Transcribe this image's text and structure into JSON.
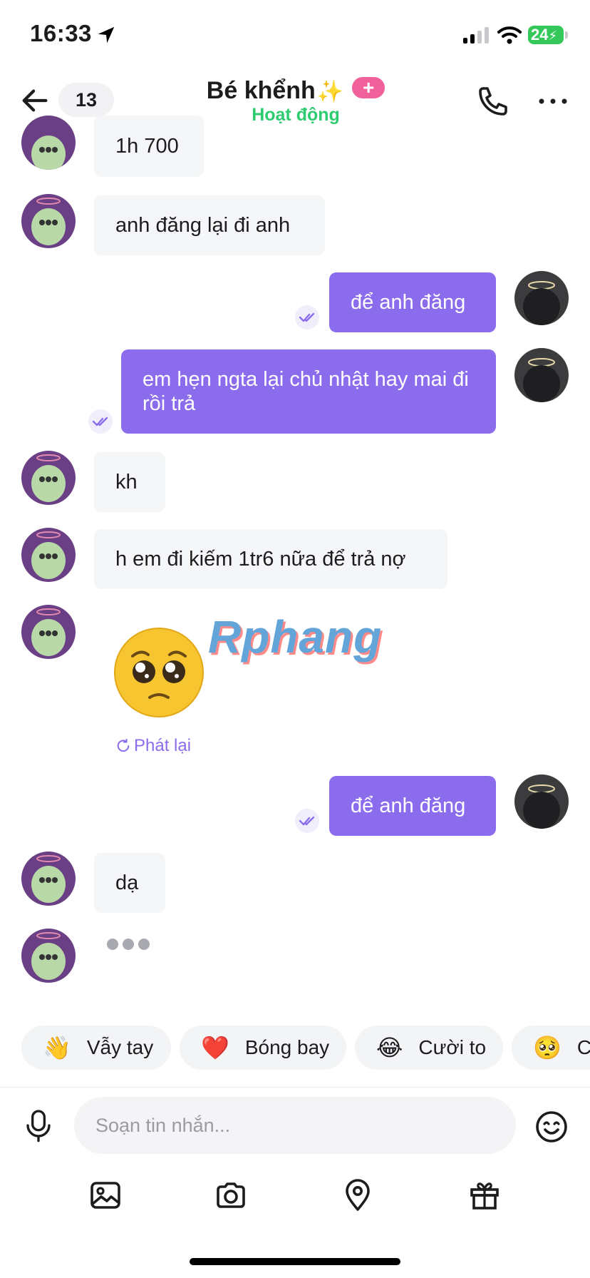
{
  "status_bar": {
    "time": "16:33",
    "battery": "24"
  },
  "header": {
    "unread_count": "13",
    "contact_name": "Bé khểnh",
    "name_emoji": "✨",
    "plus_label": "+",
    "status": "Hoạt động"
  },
  "messages": [
    {
      "from": "them",
      "text": "1h 700"
    },
    {
      "from": "them",
      "text": "anh đăng lại đi anh"
    },
    {
      "from": "me",
      "text": "để anh đăng"
    },
    {
      "from": "me",
      "text": "em hẹn ngta lại chủ nhật hay mai đi rồi trả"
    },
    {
      "from": "them",
      "text": "kh"
    },
    {
      "from": "them",
      "text": "h em đi kiếm 1tr6 nữa để trả nợ"
    },
    {
      "from": "them",
      "sticker": "pleading-face",
      "replay_label": "Phát lại"
    },
    {
      "from": "me",
      "text": "để anh đăng"
    },
    {
      "from": "them",
      "text": "dạ"
    },
    {
      "from": "them",
      "typing": true
    }
  ],
  "watermark": "Rphang",
  "quick_reactions": [
    {
      "emoji": "👋",
      "label": "Vẫy tay"
    },
    {
      "emoji": "❤️",
      "label": "Bóng bay"
    },
    {
      "emoji": "😂",
      "label": "Cười to"
    },
    {
      "emoji": "🥺",
      "label": "C"
    }
  ],
  "composer": {
    "placeholder": "Soạn tin nhắn..."
  },
  "toolbar": [
    "image-icon",
    "camera-icon",
    "location-icon",
    "gift-icon"
  ],
  "colors": {
    "accent": "#8b6cec",
    "online": "#2ecc71",
    "incoming_bubble": "#f5f6f8"
  }
}
